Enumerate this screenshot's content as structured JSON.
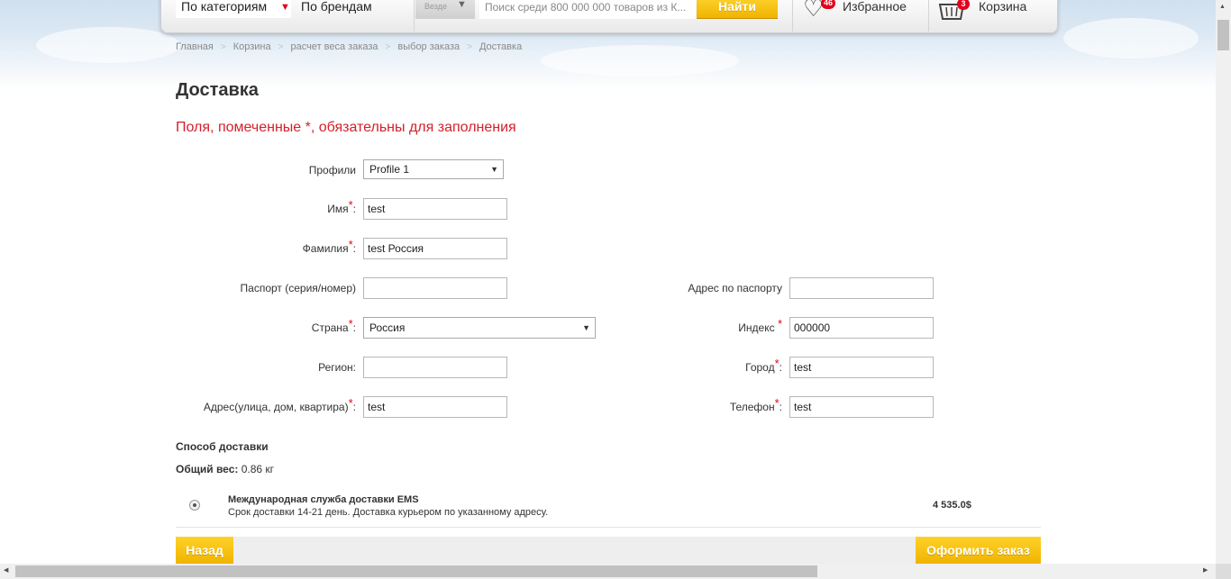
{
  "header": {
    "nav_categories": "По категориям",
    "nav_brands": "По брендам",
    "scope_label": "Везде",
    "search_placeholder": "Поиск среди 800 000 000 товаров из К...",
    "search_button": "Найти",
    "favorites_label": "Избранное",
    "favorites_count": "46",
    "cart_label": "Корзина",
    "cart_count": "3",
    "accent_color": "#f0b400",
    "badge_color": "#e2001a"
  },
  "breadcrumb": [
    "Главная",
    "Корзина",
    "расчет веса заказа",
    "выбор заказа",
    "Доставка"
  ],
  "page": {
    "title": "Доставка",
    "required_note": "Поля, помеченные *, обязательны для заполнения"
  },
  "form": {
    "profiles_label": "Профили",
    "profiles_value": "Profile 1",
    "name_label": "Имя",
    "name_value": "test",
    "surname_label": "Фамилия",
    "surname_value": "test Россия",
    "passport_label": "Паспорт (серия/номер)",
    "passport_value": "",
    "passport_address_label": "Адрес по паспорту",
    "passport_address_value": "",
    "country_label": "Страна",
    "country_value": "Россия",
    "index_label": "Индекс",
    "index_value": "000000",
    "region_label": "Регион:",
    "region_value": "",
    "city_label": "Город",
    "city_value": "test",
    "address_label": "Адрес(улица, дом, квартира)",
    "address_value": "test",
    "phone_label": "Телефон",
    "phone_value": "test",
    "colon": ":",
    "star": "*"
  },
  "delivery": {
    "section_title": "Способ доставки",
    "weight_label": "Общий вес:",
    "weight_value": "0.86 кг",
    "option_name": "Международная служба доставки EMS",
    "option_desc": "Срок доставки 14-21 день. Доставка курьером по указанному адресу.",
    "option_price": "4 535.0$"
  },
  "actions": {
    "back": "Назад",
    "checkout": "Оформить заказ"
  }
}
